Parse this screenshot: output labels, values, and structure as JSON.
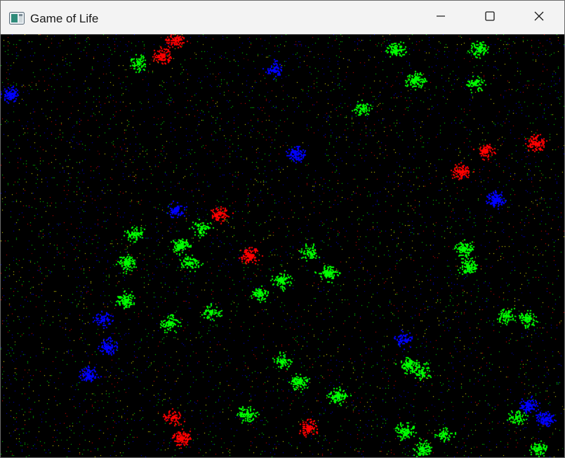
{
  "window": {
    "title": "Game of Life",
    "controls": {
      "minimize_icon": "minimize-icon",
      "maximize_icon": "maximize-icon",
      "close_icon": "close-icon"
    },
    "app_icon": "window-app-icon"
  },
  "simulation": {
    "background_color": "#000000",
    "species_colors": {
      "green": "#00ff00",
      "red": "#ff0000",
      "blue": "#0000ff",
      "yellow": "#ffff00"
    }
  }
}
